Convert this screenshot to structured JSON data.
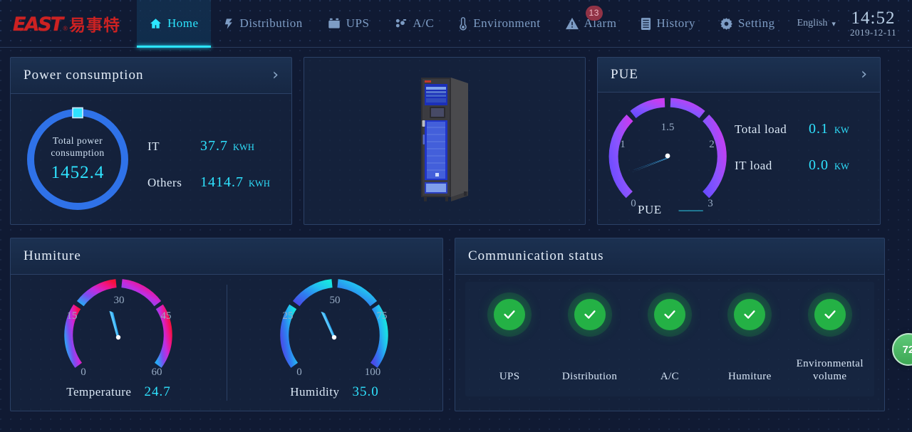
{
  "header": {
    "logo": {
      "en": "EAST",
      "registered": "®",
      "cn": "易事特"
    },
    "nav": [
      {
        "label": "Home",
        "icon": "home-icon",
        "active": true
      },
      {
        "label": "Distribution",
        "icon": "lightning-icon",
        "active": false
      },
      {
        "label": "UPS",
        "icon": "battery-icon",
        "active": false
      },
      {
        "label": "A/C",
        "icon": "fan-icon",
        "active": false
      },
      {
        "label": "Environment",
        "icon": "thermometer-icon",
        "active": false
      },
      {
        "label": "Alarm",
        "icon": "warning-icon",
        "active": false,
        "badge": "13"
      },
      {
        "label": "History",
        "icon": "document-icon",
        "active": false
      },
      {
        "label": "Setting",
        "icon": "gear-icon",
        "active": false
      }
    ],
    "language": "English",
    "time": "14:52",
    "date": "2019-12-11"
  },
  "power_consumption": {
    "title": "Power consumption",
    "donut_label_line1": "Total power",
    "donut_label_line2": "consumption",
    "donut_value": "1452.4",
    "rows": [
      {
        "key": "IT",
        "value": "37.7",
        "unit": "KWH"
      },
      {
        "key": "Others",
        "value": "1414.7",
        "unit": "KWH"
      }
    ]
  },
  "rack": {
    "brand": "EAST"
  },
  "pue": {
    "title": "PUE",
    "rows": [
      {
        "key": "Total load",
        "value": "0.1",
        "unit": "KW"
      },
      {
        "key": "IT load",
        "value": "0.0",
        "unit": "KW"
      }
    ],
    "footer_key": "PUE",
    "footer_value": "——"
  },
  "humiture": {
    "title": "Humiture",
    "gauges": [
      {
        "name": "Temperature",
        "value": "24.7",
        "ticks": [
          "0",
          "15",
          "30",
          "45",
          "60"
        ],
        "min": 0,
        "max": 60,
        "reading": 24.7
      },
      {
        "name": "Humidity",
        "value": "35.0",
        "ticks": [
          "0",
          "25",
          "50",
          "75",
          "100"
        ],
        "min": 0,
        "max": 100,
        "reading": 35.0
      }
    ]
  },
  "communication": {
    "title": "Communication status",
    "items": [
      {
        "label": "UPS",
        "status": "ok"
      },
      {
        "label": "Distribution",
        "status": "ok"
      },
      {
        "label": "A/C",
        "status": "ok"
      },
      {
        "label": "Humiture",
        "status": "ok"
      },
      {
        "label": "Environmental\nvolume",
        "status": "ok"
      }
    ]
  },
  "edge_badge": {
    "label": "72"
  },
  "chart_data": [
    {
      "type": "pie",
      "title": "Total power consumption",
      "categories": [
        "IT",
        "Others"
      ],
      "values": [
        37.7,
        1414.7
      ],
      "total": 1452.4,
      "unit": "KWH"
    },
    {
      "type": "gauge",
      "title": "PUE",
      "ticks": [
        "0",
        "1",
        "1.5",
        "2",
        "3"
      ],
      "axis_range": [
        0,
        3
      ],
      "value": null,
      "value_label": "——"
    },
    {
      "type": "gauge",
      "title": "Temperature",
      "ticks": [
        "0",
        "15",
        "30",
        "45",
        "60"
      ],
      "axis_range": [
        0,
        60
      ],
      "value": 24.7
    },
    {
      "type": "gauge",
      "title": "Humidity",
      "ticks": [
        "0",
        "25",
        "50",
        "75",
        "100"
      ],
      "axis_range": [
        0,
        100
      ],
      "value": 35.0
    }
  ],
  "colors": {
    "accent_cyan": "#2fe3ff",
    "panel_border": "#2b4166",
    "background": "#101a33",
    "brand_red": "#cc2222",
    "status_green": "#24b145",
    "alarm_badge": "#913346"
  }
}
